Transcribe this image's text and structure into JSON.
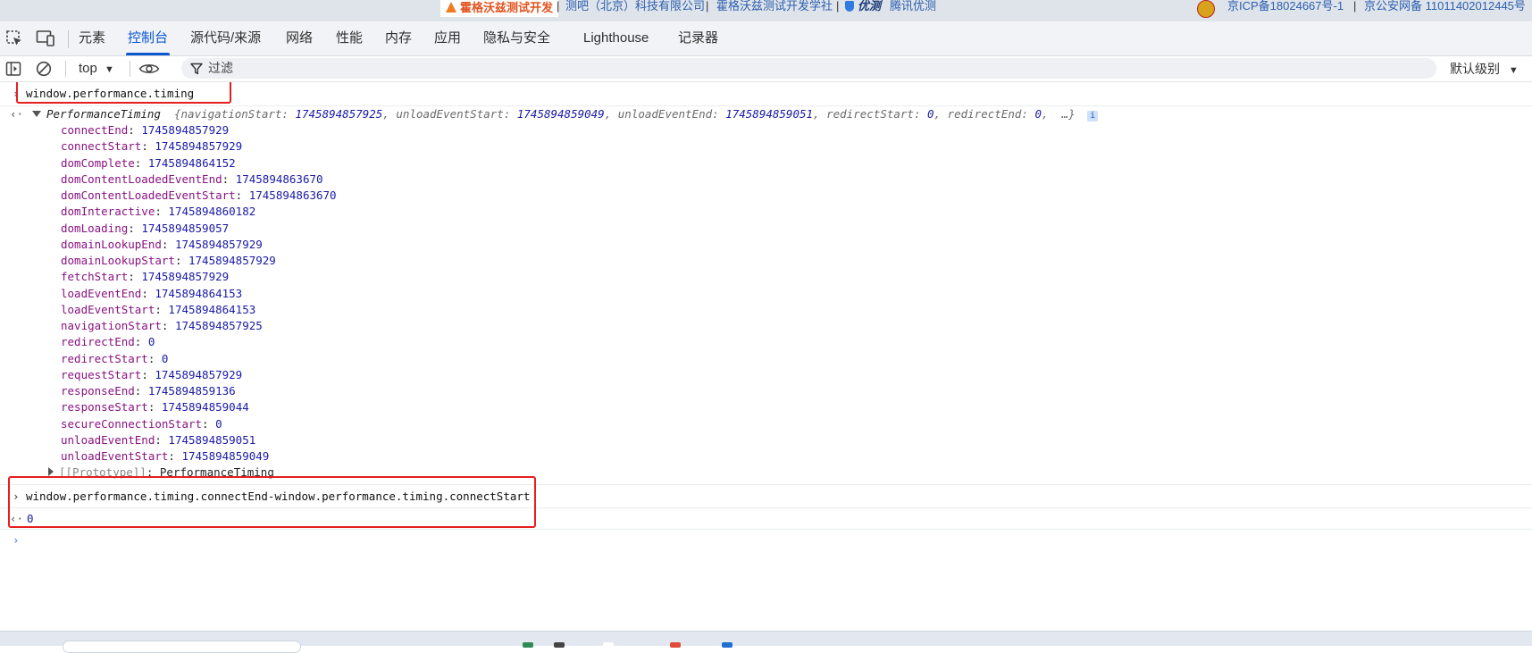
{
  "website_strip": {
    "brand": "霍格沃兹测试开发",
    "links": [
      "测吧（北京）科技有限公司",
      "霍格沃兹测试开发学社",
      "优测",
      "腾讯优测"
    ],
    "icp": "京ICP备18024667号-1",
    "police": "京公安网备 11011402012445号"
  },
  "devtools": {
    "tabs": [
      "元素",
      "控制台",
      "源代码/来源",
      "网络",
      "性能",
      "内存",
      "应用",
      "隐私与安全",
      "Lighthouse",
      "记录器"
    ],
    "active_tab": "控制台",
    "toolbar": {
      "context": "top",
      "filter_placeholder": "过滤",
      "levels": "默认级别"
    }
  },
  "console": {
    "command1": "window.performance.timing",
    "object": {
      "name": "PerformanceTiming",
      "preview": [
        {
          "k": "navigationStart",
          "v": "1745894857925"
        },
        {
          "k": "unloadEventStart",
          "v": "1745894859049"
        },
        {
          "k": "unloadEventEnd",
          "v": "1745894859051"
        },
        {
          "k": "redirectStart",
          "v": "0"
        },
        {
          "k": "redirectEnd",
          "v": "0"
        }
      ],
      "preview_tail": "…}",
      "info": "i",
      "properties": [
        {
          "key": "connectEnd",
          "value": "1745894857929"
        },
        {
          "key": "connectStart",
          "value": "1745894857929"
        },
        {
          "key": "domComplete",
          "value": "1745894864152"
        },
        {
          "key": "domContentLoadedEventEnd",
          "value": "1745894863670"
        },
        {
          "key": "domContentLoadedEventStart",
          "value": "1745894863670"
        },
        {
          "key": "domInteractive",
          "value": "1745894860182"
        },
        {
          "key": "domLoading",
          "value": "1745894859057"
        },
        {
          "key": "domainLookupEnd",
          "value": "1745894857929"
        },
        {
          "key": "domainLookupStart",
          "value": "1745894857929"
        },
        {
          "key": "fetchStart",
          "value": "1745894857929"
        },
        {
          "key": "loadEventEnd",
          "value": "1745894864153"
        },
        {
          "key": "loadEventStart",
          "value": "1745894864153"
        },
        {
          "key": "navigationStart",
          "value": "1745894857925"
        },
        {
          "key": "redirectEnd",
          "value": "0"
        },
        {
          "key": "redirectStart",
          "value": "0"
        },
        {
          "key": "requestStart",
          "value": "1745894857929"
        },
        {
          "key": "responseEnd",
          "value": "1745894859136"
        },
        {
          "key": "responseStart",
          "value": "1745894859044"
        },
        {
          "key": "secureConnectionStart",
          "value": "0"
        },
        {
          "key": "unloadEventEnd",
          "value": "1745894859051"
        },
        {
          "key": "unloadEventStart",
          "value": "1745894859049"
        }
      ],
      "prototype_label": "[[Prototype]]",
      "prototype_value": "PerformanceTiming"
    },
    "command2": "window.performance.timing.connectEnd-window.performance.timing.connectStart",
    "result2": "0"
  },
  "colors": {
    "accent": "#0b57d0",
    "highlight": "#e61e1e",
    "property_key": "#881280",
    "number": "#1a1aa6"
  }
}
